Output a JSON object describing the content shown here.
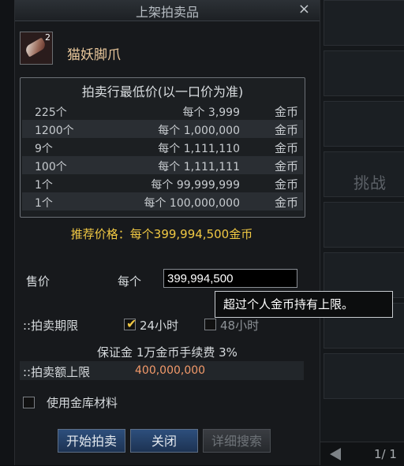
{
  "window": {
    "title": "上架拍卖品",
    "close_label": "×"
  },
  "item": {
    "name": "猫妖脚爪",
    "count": "2",
    "icon": "claw-icon"
  },
  "price_table": {
    "header": "拍卖行最低价(以一口价为准)",
    "rows": [
      {
        "qty": "225个",
        "each": "每个 3,999",
        "coin": "金币"
      },
      {
        "qty": "1200个",
        "each": "每个 1,000,000",
        "coin": "金币"
      },
      {
        "qty": "9个",
        "each": "每个 1,111,110",
        "coin": "金币"
      },
      {
        "qty": "100个",
        "each": "每个 1,111,111",
        "coin": "金币"
      },
      {
        "qty": "1个",
        "each": "每个 99,999,999",
        "coin": "金币"
      },
      {
        "qty": "1个",
        "each": "每个 100,000,000",
        "coin": "金币"
      }
    ],
    "recommend": "推荐价格：每个399,994,500金币"
  },
  "sale": {
    "label": "售价",
    "each_label": "每个",
    "price_value": "399,994,500",
    "tooltip": "超过个人金币持有上限。"
  },
  "period": {
    "label": "::拍卖期限",
    "option_24": "24小时",
    "option_48": "48小时",
    "selected": "24小时"
  },
  "deposit": {
    "text": "保证金 1万金币手续费 3%"
  },
  "limit": {
    "label": "::拍卖额上限",
    "value": "400,000,000"
  },
  "storage": {
    "label": "使用金库材料",
    "checked": false
  },
  "buttons": {
    "start": "开始拍卖",
    "close": "关闭",
    "search": "详细搜索"
  },
  "background": {
    "challenge_text": "挑战",
    "pager": "1/ 1"
  },
  "colors": {
    "gold": "#f0c843",
    "item_name": "#e9c79b",
    "limit_value": "#f39a6a",
    "button_blue": "#2d4f7c"
  }
}
